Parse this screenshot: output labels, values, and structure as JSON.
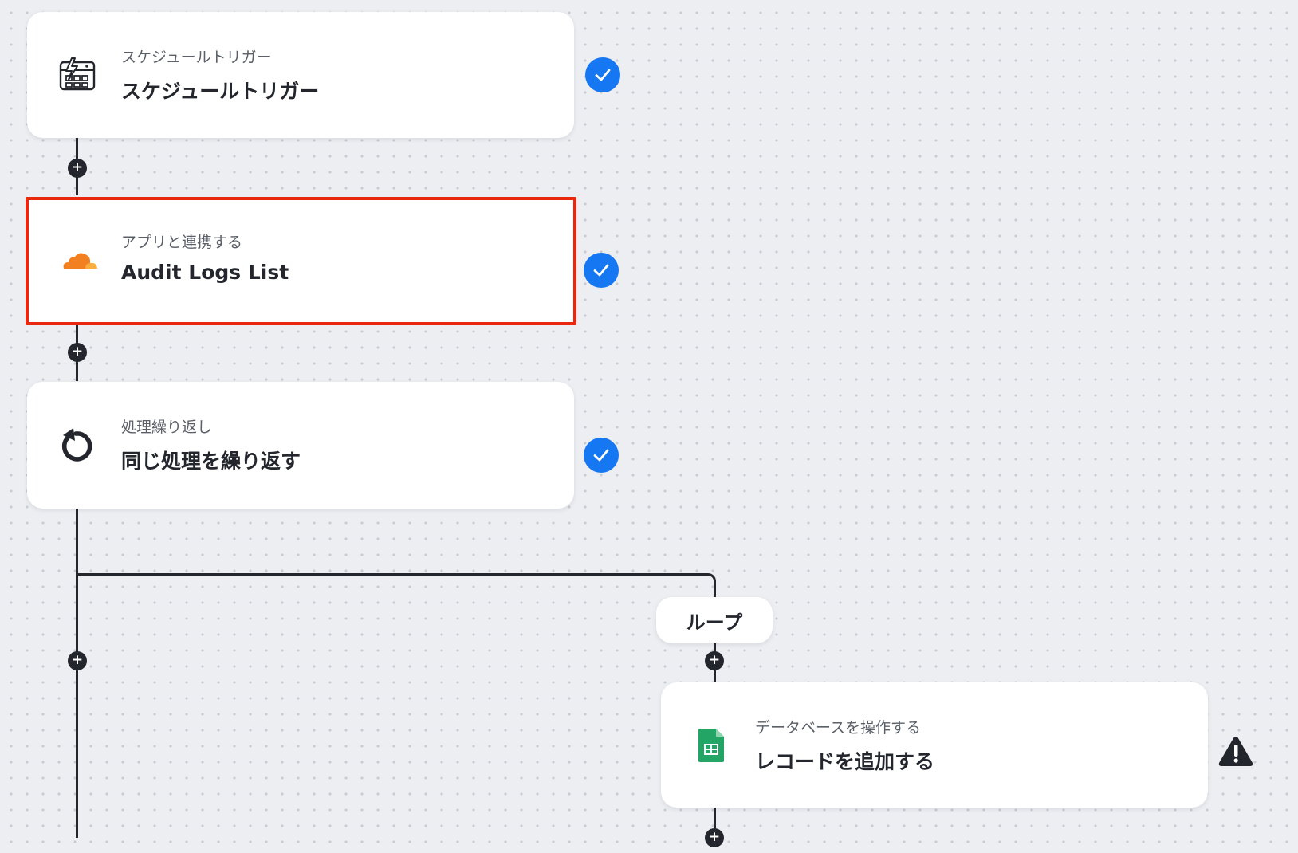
{
  "flow": {
    "steps": [
      {
        "category": "スケジュールトリガー",
        "title": "スケジュールトリガー",
        "icon": "schedule-trigger-icon",
        "status": "complete"
      },
      {
        "category": "アプリと連携する",
        "title": "Audit Logs List",
        "icon": "cloudflare-icon",
        "status": "complete",
        "selected": true
      },
      {
        "category": "処理繰り返し",
        "title": "同じ処理を繰り返す",
        "icon": "repeat-icon",
        "status": "complete"
      }
    ],
    "loop": {
      "label": "ループ",
      "steps": [
        {
          "category": "データベースを操作する",
          "title": "レコードを追加する",
          "icon": "google-sheets-icon",
          "status": "warning"
        }
      ]
    }
  },
  "colors": {
    "canvas_bg": "#eceef2",
    "check_blue": "#1677f2",
    "selection_red": "#e8280f",
    "cloudflare_orange": "#f38020",
    "cloudflare_light": "#faad3f",
    "sheets_green": "#23a566",
    "line_dark": "#23262d"
  }
}
